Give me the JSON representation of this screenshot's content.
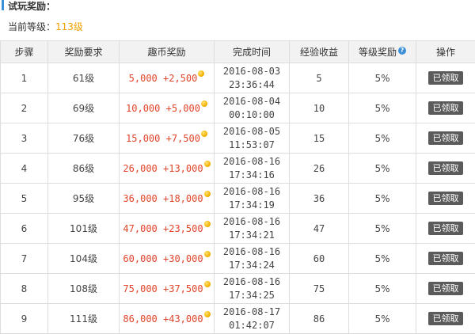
{
  "section": {
    "title": "试玩奖励："
  },
  "level": {
    "label": "当前等级：",
    "value": "113级"
  },
  "table": {
    "headers": [
      "步骤",
      "奖励要求",
      "趣币奖励",
      "完成时间",
      "经验收益",
      "等级奖励",
      "操作"
    ],
    "help_icon_glyph": "?",
    "rows": [
      {
        "step": "1",
        "requirement": "61级",
        "reward": "5,000 +2,500",
        "date": "2016-08-03",
        "time": "23:36:44",
        "exp": "5",
        "bonus": "5%",
        "action": "已领取"
      },
      {
        "step": "2",
        "requirement": "69级",
        "reward": "10,000 +5,000",
        "date": "2016-08-04",
        "time": "00:10:00",
        "exp": "10",
        "bonus": "5%",
        "action": "已领取"
      },
      {
        "step": "3",
        "requirement": "76级",
        "reward": "15,000 +7,500",
        "date": "2016-08-05",
        "time": "11:53:07",
        "exp": "15",
        "bonus": "5%",
        "action": "已领取"
      },
      {
        "step": "4",
        "requirement": "86级",
        "reward": "26,000 +13,000",
        "date": "2016-08-16",
        "time": "17:34:16",
        "exp": "26",
        "bonus": "5%",
        "action": "已领取"
      },
      {
        "step": "5",
        "requirement": "95级",
        "reward": "36,000 +18,000",
        "date": "2016-08-16",
        "time": "17:34:19",
        "exp": "36",
        "bonus": "5%",
        "action": "已领取"
      },
      {
        "step": "6",
        "requirement": "101级",
        "reward": "47,000 +23,500",
        "date": "2016-08-16",
        "time": "17:34:21",
        "exp": "47",
        "bonus": "5%",
        "action": "已领取"
      },
      {
        "step": "7",
        "requirement": "104级",
        "reward": "60,000 +30,000",
        "date": "2016-08-16",
        "time": "17:34:24",
        "exp": "60",
        "bonus": "5%",
        "action": "已领取"
      },
      {
        "step": "8",
        "requirement": "108级",
        "reward": "75,000 +37,500",
        "date": "2016-08-16",
        "time": "17:34:25",
        "exp": "75",
        "bonus": "5%",
        "action": "已领取"
      },
      {
        "step": "9",
        "requirement": "111级",
        "reward": "86,000 +43,000",
        "date": "2016-08-17",
        "time": "01:42:07",
        "exp": "86",
        "bonus": "5%",
        "action": "已领取"
      }
    ]
  },
  "colors": {
    "accent": "#3a8fd8",
    "reward_text": "#e0442a",
    "level_value": "#f0a000",
    "claimed_button": "#5b5b5b"
  },
  "icons": {
    "coin": "coin-icon",
    "help": "help-icon"
  }
}
